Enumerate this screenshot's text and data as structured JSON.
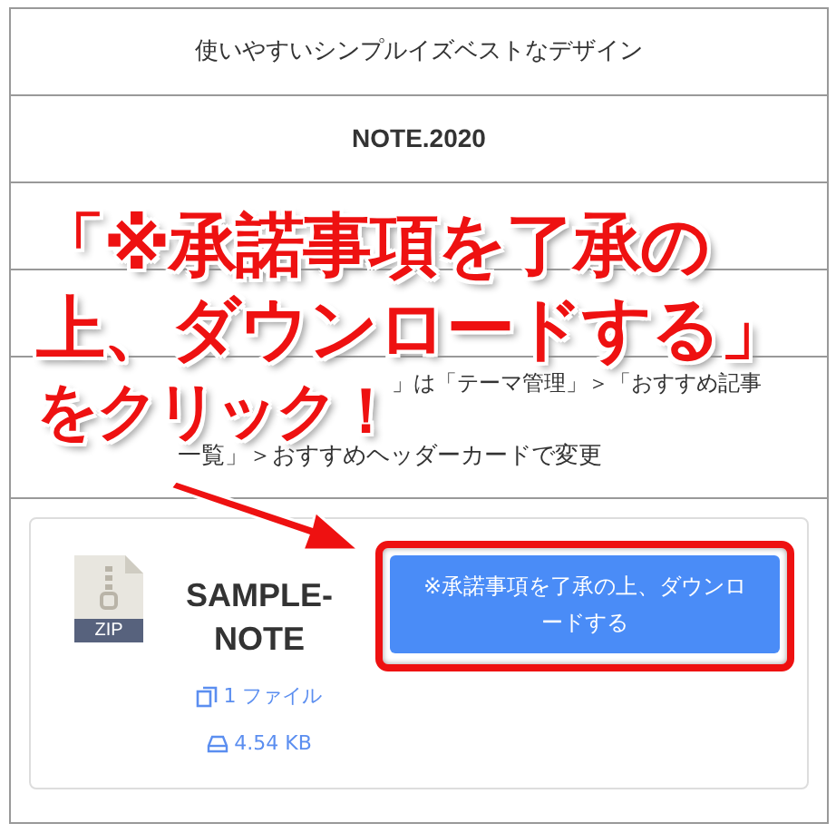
{
  "rows": [
    {
      "kind": "text",
      "text": "使いやすいシンプルイズベストなデザイン"
    },
    {
      "kind": "bold",
      "text": "NOTE.2020"
    },
    {
      "kind": "empty"
    },
    {
      "kind": "empty"
    },
    {
      "kind": "lines",
      "lines": [
        "」は「テーマ管理」＞「おすすめ記事",
        "一覧」＞おすすめヘッダーカードで変更"
      ]
    }
  ],
  "download_card": {
    "file_type": "ZIP",
    "title": "SAMPLE-NOTE",
    "file_count": "1 ファイル",
    "size": "4.54 KB",
    "button": "※承諾事項を了承の上、ダウンロードする"
  },
  "annotation": {
    "lines": [
      "「※承諾事項を了承の",
      "上、ダウンロードする」",
      "をクリック！"
    ]
  }
}
